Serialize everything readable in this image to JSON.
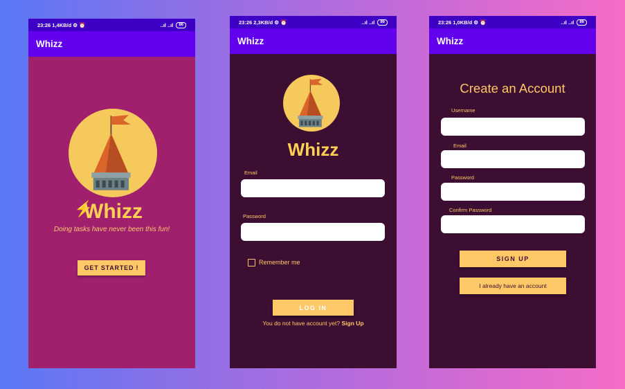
{
  "colors": {
    "status_bar": "#3d00c4",
    "app_bar": "#6200ee",
    "screen1_bg": "#a0206e",
    "screen_bg": "#3c0e32",
    "accent": "#ffc867",
    "logo_sun": "#f5c95c"
  },
  "icons": [
    "castle-logo-icon",
    "lightning-bolt-icon",
    "signal-icon",
    "battery-icon",
    "alarm-icon"
  ],
  "screens": [
    {
      "status": {
        "time": "23:26",
        "speed": "1,4KB/d ⚙ ⏰",
        "signal": "..ıl ..ıl",
        "battery": "86"
      },
      "app_title": "Whizz",
      "brand": "Whizz",
      "tagline": "Doing tasks have never been this fun!",
      "cta": "GET STARTED !"
    },
    {
      "status": {
        "time": "23:26",
        "speed": "2,3KB/d ⚙ ⏰",
        "signal": "..ıl ..ıl",
        "battery": "86"
      },
      "app_title": "Whizz",
      "brand": "Whizz",
      "email_label": "Email",
      "email_value": "",
      "password_label": "Password",
      "password_value": "",
      "remember_label": "Remember me",
      "remember_checked": false,
      "login_label": "LOG IN",
      "no_account_text": "You do not have account yet?",
      "signup_link": "Sign Up"
    },
    {
      "status": {
        "time": "23:26",
        "speed": "1,0KB/d ⚙ ⏰",
        "signal": "..ıl ..ıl",
        "battery": "86"
      },
      "app_title": "Whizz",
      "heading": "Create an Account",
      "username_label": "Username",
      "email_label": "Email",
      "password_label": "Password",
      "confirm_label": "Confirm Password",
      "signup_label": "SIGN UP",
      "have_account_label": "I already have an account"
    }
  ]
}
